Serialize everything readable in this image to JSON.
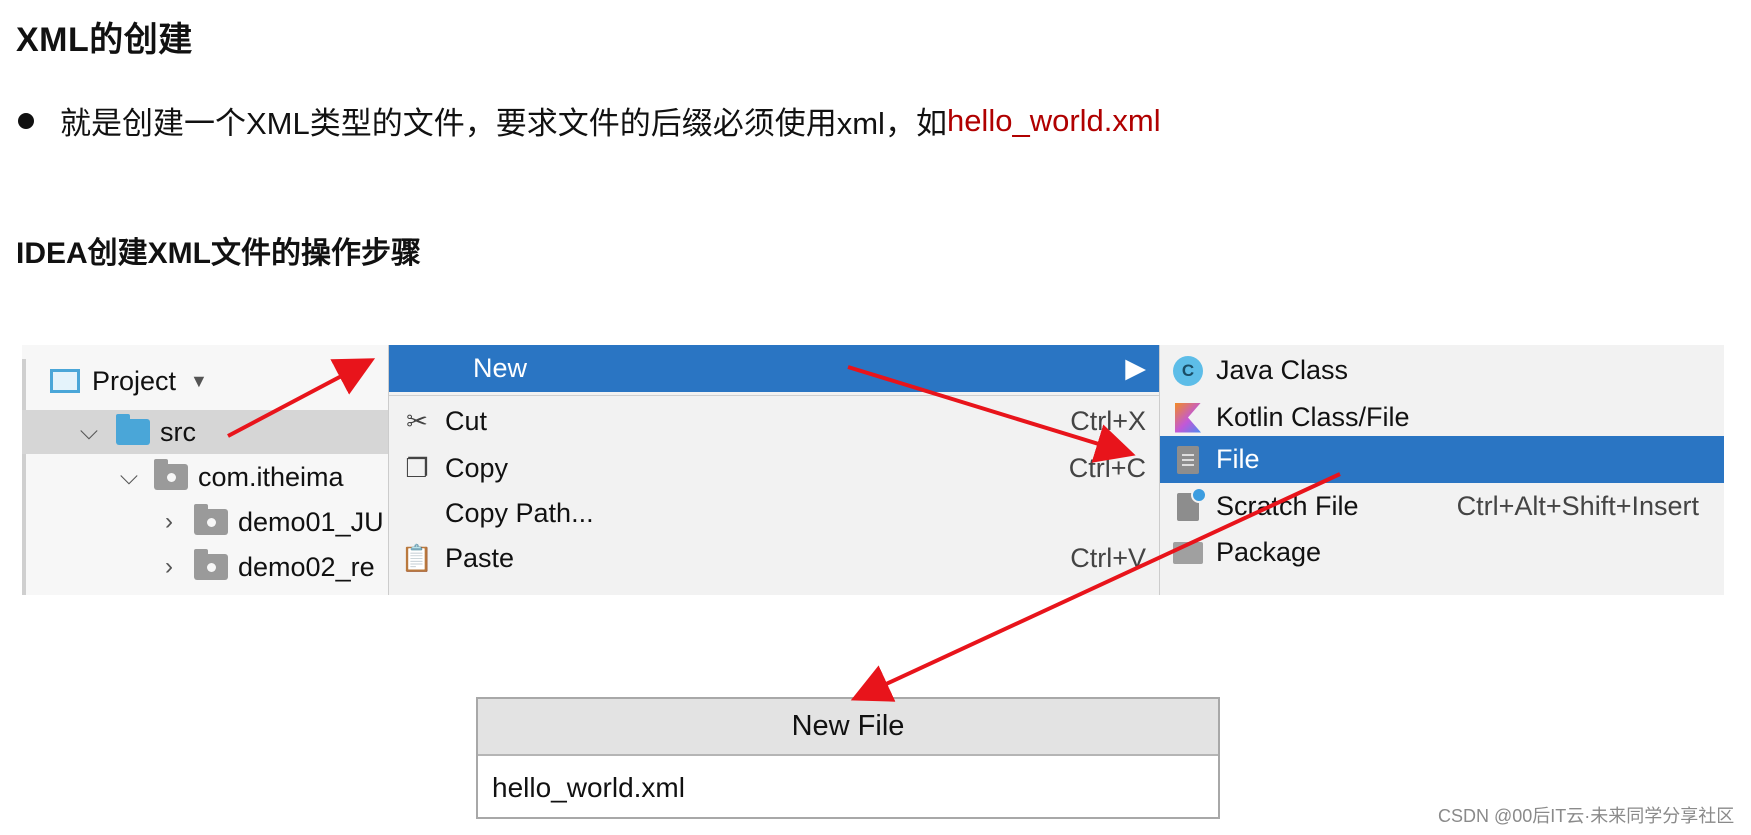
{
  "heading": "XML的创建",
  "bullet": {
    "text": "就是创建一个XML类型的文件，要求文件的后缀必须使用xml，如",
    "highlight": "hello_world.xml",
    "highlight_color": "#b00000"
  },
  "subheading": "IDEA创建XML文件的操作步骤",
  "project_panel": {
    "header": "Project",
    "rows": [
      {
        "label": "src"
      },
      {
        "label": "com.itheima"
      },
      {
        "label": "demo01_JU"
      },
      {
        "label": "demo02_re"
      }
    ]
  },
  "context_menu": {
    "items": [
      {
        "label": "New",
        "shortcut": ""
      },
      {
        "label": "Cut",
        "shortcut": "Ctrl+X"
      },
      {
        "label": "Copy",
        "shortcut": "Ctrl+C"
      },
      {
        "label": "Copy Path...",
        "shortcut": ""
      },
      {
        "label": "Paste",
        "shortcut": "Ctrl+V"
      }
    ],
    "highlight_color": "#2a75c3"
  },
  "new_submenu": {
    "items": [
      {
        "label": "Java Class",
        "shortcut": "",
        "icon": "java-class-icon"
      },
      {
        "label": "Kotlin Class/File",
        "shortcut": "",
        "icon": "kotlin-icon"
      },
      {
        "label": "File",
        "shortcut": "",
        "icon": "file-icon"
      },
      {
        "label": "Scratch File",
        "shortcut": "Ctrl+Alt+Shift+Insert",
        "icon": "scratch-file-icon"
      },
      {
        "label": "Package",
        "shortcut": "",
        "icon": "package-icon"
      }
    ]
  },
  "dialog": {
    "title": "New File",
    "value": "hello_world.xml"
  },
  "watermark": "CSDN @00后IT云·未来同学分享社区",
  "arrow_color": "#e8141b"
}
